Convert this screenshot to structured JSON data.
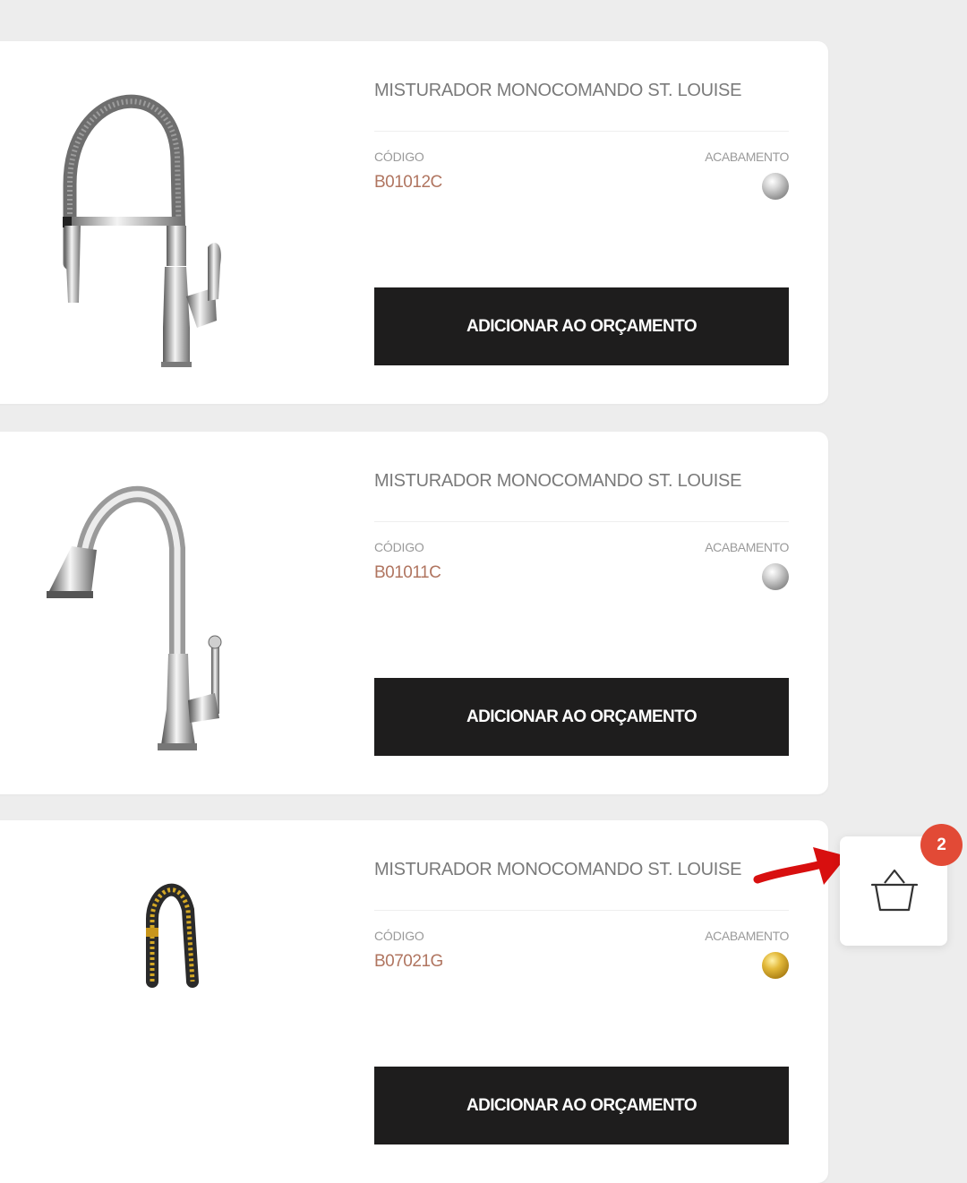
{
  "products": [
    {
      "title": "MISTURADOR MONOCOMANDO ST. LOUISE",
      "code_label": "CÓDIGO",
      "code": "B01012C",
      "finish_label": "ACABAMENTO",
      "finish": "chrome",
      "button_label": "ADICIONAR AO ORÇAMENTO",
      "image": "spring-spout-faucet-chrome"
    },
    {
      "title": "MISTURADOR MONOCOMANDO ST. LOUISE",
      "code_label": "CÓDIGO",
      "code": "B01011C",
      "finish_label": "ACABAMENTO",
      "finish": "chrome",
      "button_label": "ADICIONAR AO ORÇAMENTO",
      "image": "pull-down-faucet-chrome"
    },
    {
      "title": "MISTURADOR MONOCOMANDO ST. LOUISE",
      "code_label": "CÓDIGO",
      "code": "B07021G",
      "finish_label": "ACABAMENTO",
      "finish": "gold",
      "button_label": "ADICIONAR AO ORÇAMENTO",
      "image": "spring-spout-faucet-gold"
    }
  ],
  "cart": {
    "count": "2",
    "icon": "basket-icon"
  },
  "annotation": {
    "icon": "red-arrow-pointing-to-cart"
  },
  "colors": {
    "background": "#ededed",
    "button": "#1e1d1d",
    "code_text": "#b07560",
    "badge": "#e24a36",
    "arrow": "#d80f0f"
  }
}
